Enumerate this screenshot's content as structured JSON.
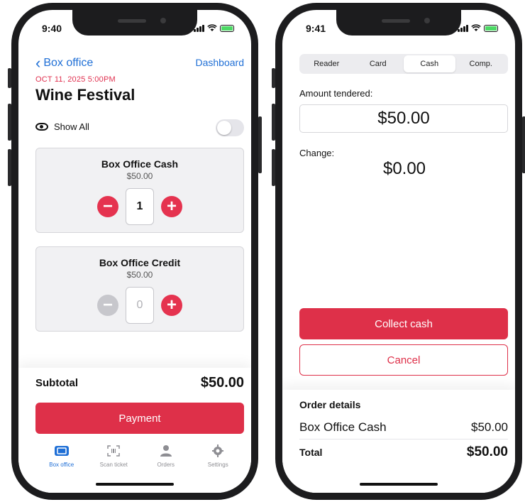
{
  "left": {
    "status_time": "9:40",
    "nav": {
      "back_label": "Box office",
      "dashboard_label": "Dashboard"
    },
    "event": {
      "date": "OCT 11, 2025  5:00PM",
      "title": "Wine Festival"
    },
    "show_all": {
      "label": "Show All",
      "enabled": false
    },
    "tickets": [
      {
        "name": "Box Office Cash",
        "price": "$50.00",
        "quantity": "1",
        "decrement_enabled": true
      },
      {
        "name": "Box Office Credit",
        "price": "$50.00",
        "quantity": "0",
        "decrement_enabled": false
      }
    ],
    "subtotal": {
      "label": "Subtotal",
      "value": "$50.00"
    },
    "payment_label": "Payment",
    "tabs": [
      {
        "label": "Box office",
        "icon": "ticket-icon",
        "active": true
      },
      {
        "label": "Scan ticket",
        "icon": "scan-icon",
        "active": false
      },
      {
        "label": "Orders",
        "icon": "person-icon",
        "active": false
      },
      {
        "label": "Settings",
        "icon": "gear-icon",
        "active": false
      }
    ]
  },
  "right": {
    "status_time": "9:41",
    "segments": [
      {
        "label": "Reader",
        "active": false
      },
      {
        "label": "Card",
        "active": false
      },
      {
        "label": "Cash",
        "active": true
      },
      {
        "label": "Comp.",
        "active": false
      }
    ],
    "amount_tendered": {
      "label": "Amount tendered:",
      "value": "$50.00"
    },
    "change": {
      "label": "Change:",
      "value": "$0.00"
    },
    "collect_label": "Collect cash",
    "cancel_label": "Cancel",
    "order_details": {
      "title": "Order details",
      "items": [
        {
          "name": "Box Office Cash",
          "price": "$50.00"
        }
      ],
      "total_label": "Total",
      "total_value": "$50.00"
    }
  },
  "colors": {
    "accent_red": "#de3049",
    "link_blue": "#1f6fd6",
    "date_red": "#e0304f"
  }
}
